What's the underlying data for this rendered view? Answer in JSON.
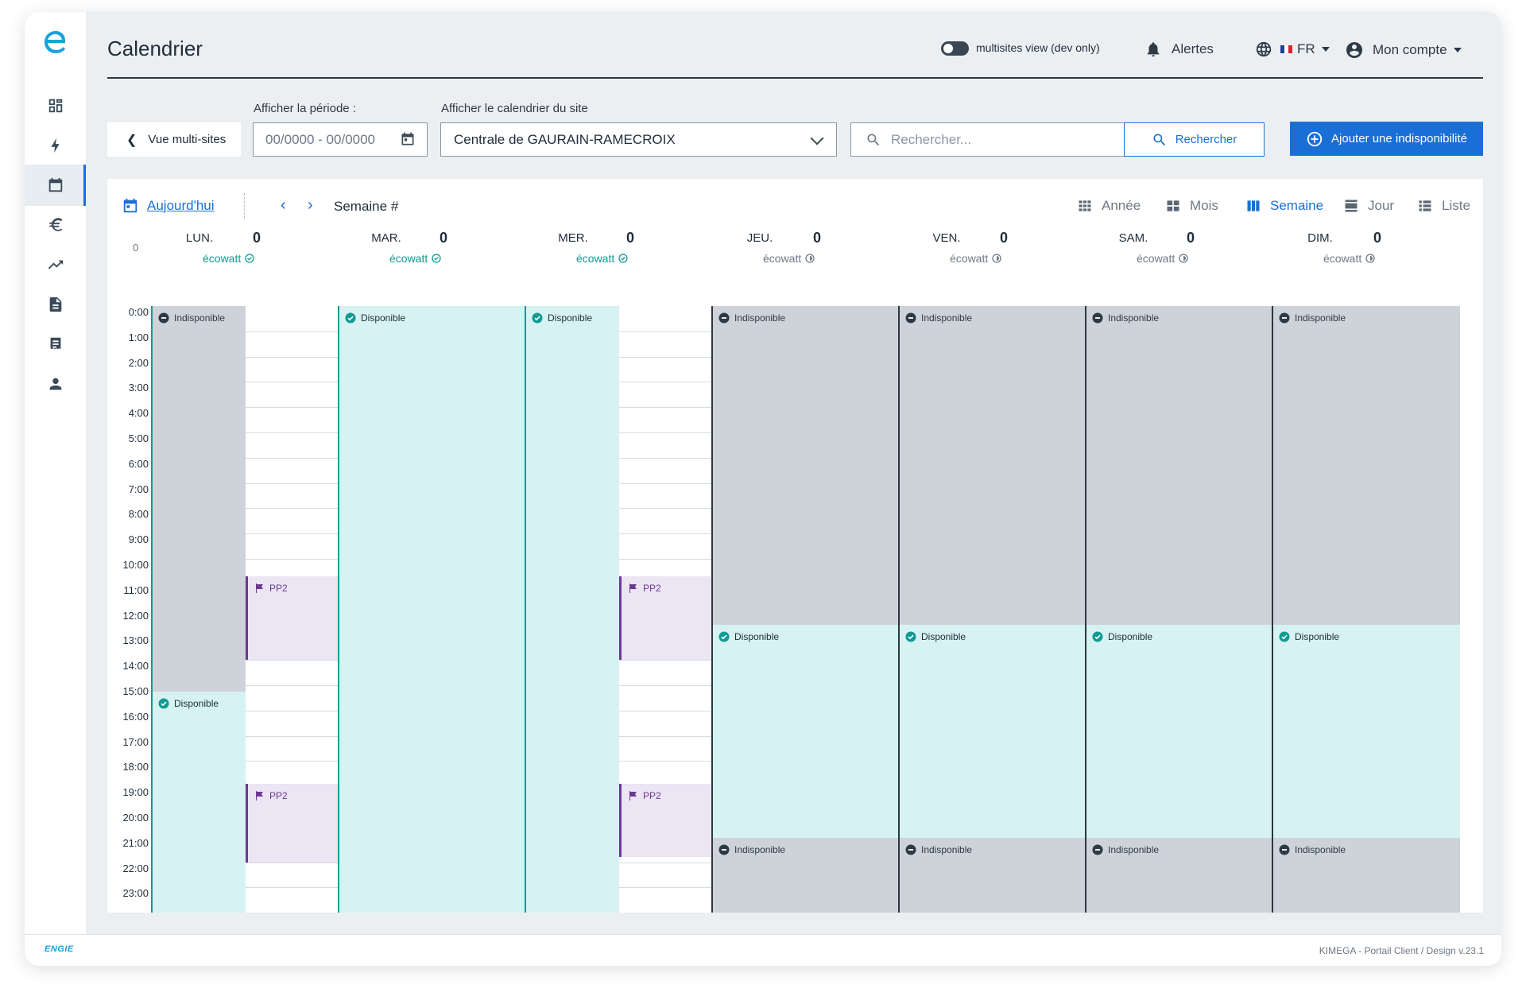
{
  "app": {
    "page_title": "Calendrier",
    "footer_brand": "ENGIE",
    "footer_version": "KIMEGA - Portail Client / Design v.23.1"
  },
  "sidebar": {
    "items": [
      {
        "name": "dashboard-icon",
        "active": false
      },
      {
        "name": "lightning-icon",
        "active": false
      },
      {
        "name": "calendar-icon",
        "active": true
      },
      {
        "name": "euro-icon",
        "active": false
      },
      {
        "name": "trending-up-icon",
        "active": false
      },
      {
        "name": "document-icon",
        "active": false
      },
      {
        "name": "receipt-icon",
        "active": false
      },
      {
        "name": "user-icon",
        "active": false
      }
    ]
  },
  "header": {
    "toggle_label": "multisites view (dev only)",
    "alerts": "Alertes",
    "language": "FR",
    "account": "Mon compte"
  },
  "filters": {
    "multi_sites": "Vue multi-sites",
    "period_label": "Afficher la période :",
    "period_value": "00/0000 - 00/0000",
    "site_label": "Afficher le calendrier du site",
    "site_value": "Centrale de GAURAIN-RAMECROIX",
    "search_placeholder": "Rechercher...",
    "search_button": "Rechercher",
    "add_button": "Ajouter une indisponibilité"
  },
  "calendar": {
    "today": "Aujourd'hui",
    "week_label": "Semaine #",
    "views": [
      "Année",
      "Mois",
      "Semaine",
      "Jour",
      "Liste"
    ],
    "active_view": "Semaine",
    "allday_count": "0",
    "days": [
      {
        "name": "LUN.",
        "count": "0",
        "sub": "écowatt",
        "status": "ok"
      },
      {
        "name": "MAR.",
        "count": "0",
        "sub": "écowatt",
        "status": "ok"
      },
      {
        "name": "MER.",
        "count": "0",
        "sub": "écowatt",
        "status": "ok"
      },
      {
        "name": "JEU.",
        "count": "0",
        "sub": "écowatt",
        "status": "pending"
      },
      {
        "name": "VEN.",
        "count": "0",
        "sub": "écowatt",
        "status": "pending"
      },
      {
        "name": "SAM.",
        "count": "0",
        "sub": "écowatt",
        "status": "pending"
      },
      {
        "name": "DIM.",
        "count": "0",
        "sub": "écowatt",
        "status": "pending"
      }
    ],
    "hours": [
      "0:00",
      "1:00",
      "2:00",
      "3:00",
      "4:00",
      "5:00",
      "6:00",
      "7:00",
      "8:00",
      "9:00",
      "10:00",
      "11:00",
      "12:00",
      "13:00",
      "14:00",
      "15:00",
      "16:00",
      "17:00",
      "18:00",
      "19:00",
      "20:00",
      "21:00",
      "22:00",
      "23:00"
    ],
    "labels": {
      "unavailable": "Indisponible",
      "available": "Disponible",
      "pp2": "PP2"
    },
    "events": [
      {
        "day": 0,
        "sub": 0,
        "type": "indispo",
        "start": 0,
        "end": 15.25
      },
      {
        "day": 0,
        "sub": 0,
        "type": "dispo",
        "start": 15.25,
        "end": 24
      },
      {
        "day": 0,
        "sub": 1,
        "type": "pp2",
        "start": 10.7,
        "end": 14
      },
      {
        "day": 0,
        "sub": 1,
        "type": "pp2",
        "start": 18.9,
        "end": 22
      },
      {
        "day": 1,
        "sub": 0,
        "type": "dispo",
        "start": 0,
        "end": 24
      },
      {
        "day": 2,
        "sub": 0,
        "type": "dispo",
        "start": 0,
        "end": 24
      },
      {
        "day": 2,
        "sub": 1,
        "type": "pp2",
        "start": 10.7,
        "end": 14
      },
      {
        "day": 2,
        "sub": 1,
        "type": "pp2",
        "start": 18.9,
        "end": 21.8
      },
      {
        "day": 3,
        "sub": 0,
        "type": "indispo",
        "start": 0,
        "end": 12.6
      },
      {
        "day": 3,
        "sub": 0,
        "type": "dispo",
        "start": 12.6,
        "end": 21.05
      },
      {
        "day": 3,
        "sub": 0,
        "type": "indispo",
        "start": 21.05,
        "end": 24
      },
      {
        "day": 4,
        "sub": 0,
        "type": "indispo",
        "start": 0,
        "end": 12.6
      },
      {
        "day": 4,
        "sub": 0,
        "type": "dispo",
        "start": 12.6,
        "end": 21.05
      },
      {
        "day": 4,
        "sub": 0,
        "type": "indispo",
        "start": 21.05,
        "end": 24
      },
      {
        "day": 5,
        "sub": 0,
        "type": "indispo",
        "start": 0,
        "end": 12.6
      },
      {
        "day": 5,
        "sub": 0,
        "type": "dispo",
        "start": 12.6,
        "end": 21.05
      },
      {
        "day": 5,
        "sub": 0,
        "type": "indispo",
        "start": 21.05,
        "end": 24
      },
      {
        "day": 6,
        "sub": 0,
        "type": "indispo",
        "start": 0,
        "end": 12.6
      },
      {
        "day": 6,
        "sub": 0,
        "type": "dispo",
        "start": 12.6,
        "end": 21.05
      },
      {
        "day": 6,
        "sub": 0,
        "type": "indispo",
        "start": 21.05,
        "end": 24
      }
    ]
  },
  "colors": {
    "primary": "#1a6fd6",
    "teal": "#109a93",
    "available_bg": "#d6f2f2",
    "unavailable_bg": "#cdd3d9",
    "pp2": "#6b3a8f",
    "pp2_bg": "#ece5f4"
  }
}
